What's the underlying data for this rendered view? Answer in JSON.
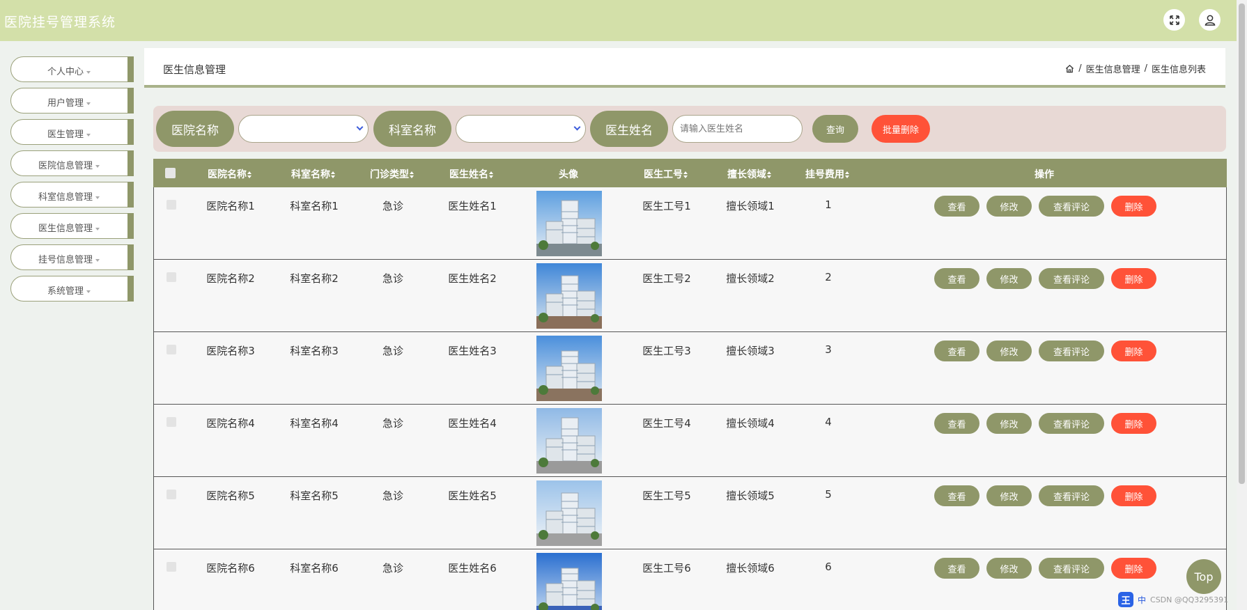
{
  "header": {
    "app_title": "医院挂号管理系统",
    "fullscreen_icon": "expand-icon",
    "user_icon": "user-icon"
  },
  "sidebar": {
    "items": [
      {
        "label": "个人中心"
      },
      {
        "label": "用户管理"
      },
      {
        "label": "医生管理"
      },
      {
        "label": "医院信息管理"
      },
      {
        "label": "科室信息管理"
      },
      {
        "label": "医生信息管理"
      },
      {
        "label": "挂号信息管理"
      },
      {
        "label": "系统管理"
      }
    ]
  },
  "page": {
    "title": "医生信息管理",
    "breadcrumb": [
      "医生信息管理",
      "医生信息列表"
    ],
    "breadcrumb_sep": "/"
  },
  "search": {
    "hospital_label": "医院名称",
    "department_label": "科室名称",
    "doctor_label": "医生姓名",
    "doctor_placeholder": "请输入医生姓名",
    "query_button": "查询",
    "batch_delete_button": "批量删除"
  },
  "colors": {
    "accent": "#8f9769",
    "header": "#d3e0a9",
    "danger": "#ff5238"
  },
  "table": {
    "columns": [
      "医院名称",
      "科室名称",
      "门诊类型",
      "医生姓名",
      "头像",
      "医生工号",
      "擅长领域",
      "挂号费用",
      "操作"
    ],
    "actions": {
      "view": "查看",
      "edit": "修改",
      "comments": "查看评论",
      "delete": "删除"
    },
    "rows": [
      {
        "hospital": "医院名称1",
        "department": "科室名称1",
        "clinic_type": "急诊",
        "doctor": "医生姓名1",
        "doctor_no": "医生工号1",
        "specialty": "擅长领域1",
        "fee": "1"
      },
      {
        "hospital": "医院名称2",
        "department": "科室名称2",
        "clinic_type": "急诊",
        "doctor": "医生姓名2",
        "doctor_no": "医生工号2",
        "specialty": "擅长领域2",
        "fee": "2"
      },
      {
        "hospital": "医院名称3",
        "department": "科室名称3",
        "clinic_type": "急诊",
        "doctor": "医生姓名3",
        "doctor_no": "医生工号3",
        "specialty": "擅长领域3",
        "fee": "3"
      },
      {
        "hospital": "医院名称4",
        "department": "科室名称4",
        "clinic_type": "急诊",
        "doctor": "医生姓名4",
        "doctor_no": "医生工号4",
        "specialty": "擅长领域4",
        "fee": "4"
      },
      {
        "hospital": "医院名称5",
        "department": "科室名称5",
        "clinic_type": "急诊",
        "doctor": "医生姓名5",
        "doctor_no": "医生工号5",
        "specialty": "擅长领域5",
        "fee": "5"
      },
      {
        "hospital": "医院名称6",
        "department": "科室名称6",
        "clinic_type": "急诊",
        "doctor": "医生姓名6",
        "doctor_no": "医生工号6",
        "specialty": "擅长领域6",
        "fee": "6"
      }
    ]
  },
  "top_button": "Top",
  "ime": {
    "mode": "中",
    "watermark": "CSDN @QQ3295391"
  }
}
